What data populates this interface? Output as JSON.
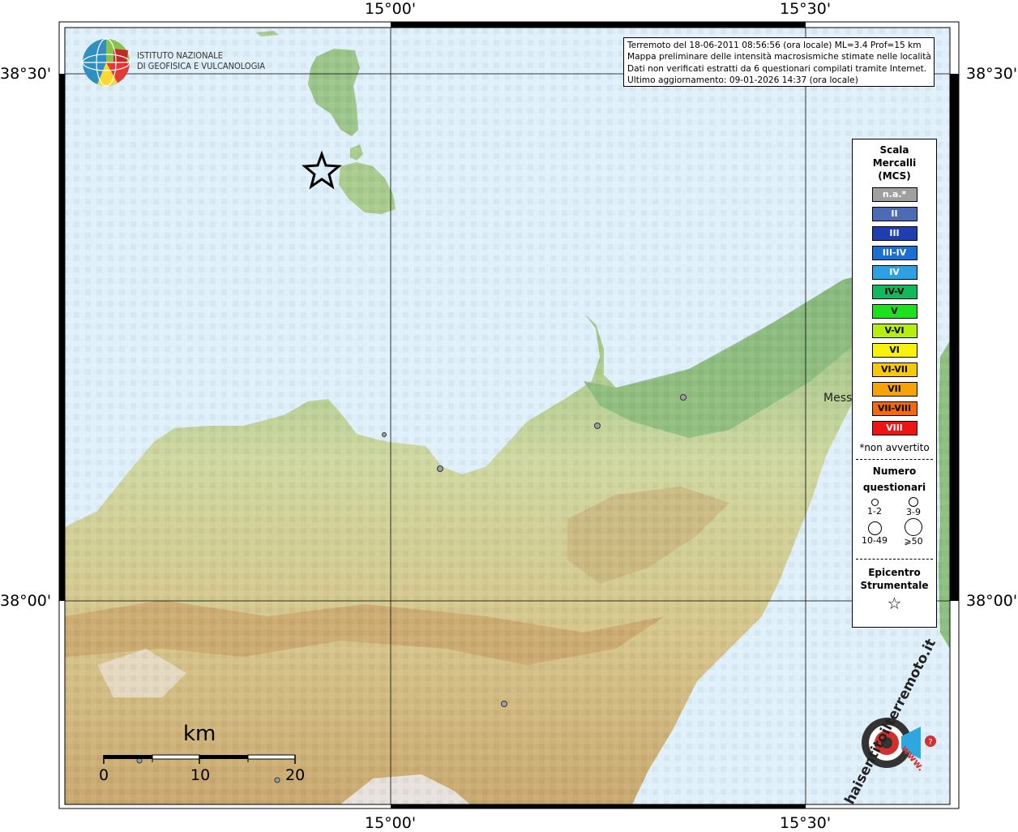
{
  "coordinates": {
    "top_labels": [
      "15°00'",
      "15°30'"
    ],
    "bottom_labels": [
      "15°00'",
      "15°30'"
    ],
    "left_labels": [
      "38°30'",
      "38°00'"
    ],
    "right_labels": [
      "38°30'",
      "38°00'"
    ]
  },
  "header": {
    "org_name_line1": "ISTITUTO NAZIONALE",
    "org_name_line2": "DI GEOFISICA E VULCANOLOGIA"
  },
  "info": {
    "line1": "Terremoto del 18-06-2011 08:56:56 (ora locale) ML=3.4 Prof=15 km",
    "line2": "Mappa preliminare delle intensità macrosismiche stimate nelle località",
    "line3": "Dati non verificati estratti da 6 questionari compilati tramite Internet.",
    "line4": "Ultimo aggiornamento: 09-01-2026 14:37 (ora locale)"
  },
  "legend": {
    "title_line1": "Scala",
    "title_line2": "Mercalli",
    "title_line3": "(MCS)",
    "scale": [
      {
        "label": "n.a.*",
        "color": "#a0a0a0",
        "text_color": "#ffffff"
      },
      {
        "label": "II",
        "color": "#4d6bb5",
        "text_color": "#ffffff"
      },
      {
        "label": "III",
        "color": "#1f3fb0",
        "text_color": "#ffffff"
      },
      {
        "label": "III-IV",
        "color": "#1a6fd0",
        "text_color": "#ffffff"
      },
      {
        "label": "IV",
        "color": "#2ea0e4",
        "text_color": "#ffffff"
      },
      {
        "label": "IV-V",
        "color": "#12b85c",
        "text_color": "#000000"
      },
      {
        "label": "V",
        "color": "#1ee01e",
        "text_color": "#000000"
      },
      {
        "label": "V-VI",
        "color": "#b6ee14",
        "text_color": "#000000"
      },
      {
        "label": "VI",
        "color": "#f6f20a",
        "text_color": "#000000"
      },
      {
        "label": "VI-VII",
        "color": "#f6c80a",
        "text_color": "#000000"
      },
      {
        "label": "VII",
        "color": "#f6a20a",
        "text_color": "#000000"
      },
      {
        "label": "VII-VIII",
        "color": "#f46a0a",
        "text_color": "#000000"
      },
      {
        "label": "VIII",
        "color": "#ee1414",
        "text_color": "#ffffff"
      }
    ],
    "note": "*non avvertito",
    "questionnaires_line1": "Numero",
    "questionnaires_line2": "questionari",
    "q_labels": [
      "1-2",
      "3-9",
      "10-49",
      "⩾50"
    ],
    "epicenter_line1": "Epicentro",
    "epicenter_line2": "Strumentale"
  },
  "places": {
    "messina": "Mess"
  },
  "scalebar": {
    "title": "km",
    "ticks": [
      "0",
      "10",
      "20"
    ]
  },
  "brand": {
    "site_text": "haisentitoilterremoto.it",
    "www_text": "www."
  }
}
